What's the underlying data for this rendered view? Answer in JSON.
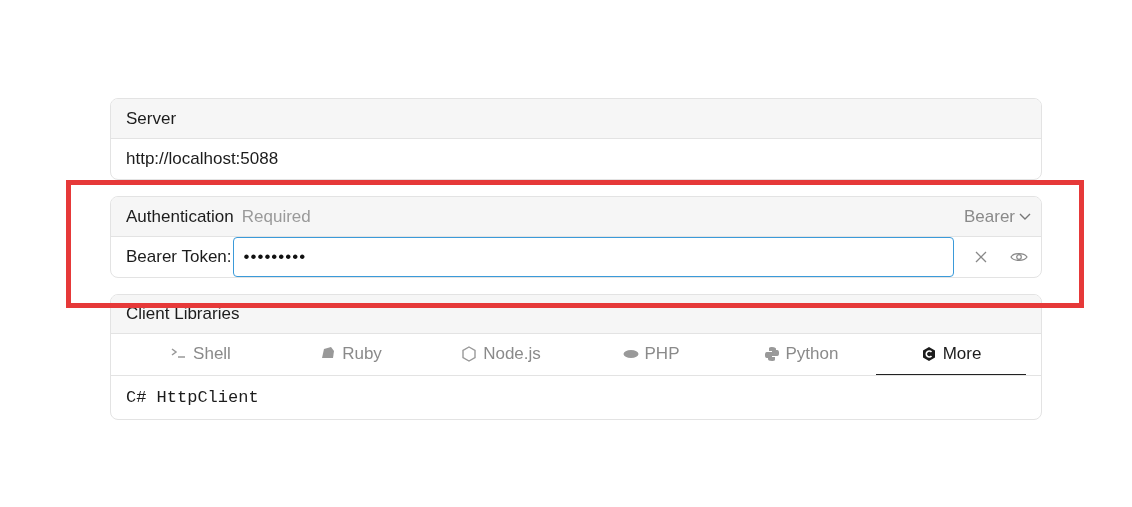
{
  "server": {
    "title": "Server",
    "url": "http://localhost:5088"
  },
  "authentication": {
    "title": "Authentication",
    "badge": "Required",
    "scheme": "Bearer",
    "token_label": "Bearer Token:",
    "token_value": "•••••••••",
    "highlighted": true
  },
  "client_libraries": {
    "title": "Client Libraries",
    "tabs": [
      {
        "label": "Shell",
        "selected": false
      },
      {
        "label": "Ruby",
        "selected": false
      },
      {
        "label": "Node.js",
        "selected": false
      },
      {
        "label": "PHP",
        "selected": false
      },
      {
        "label": "Python",
        "selected": false
      },
      {
        "label": "More",
        "selected": true
      }
    ],
    "client": "C# HttpClient"
  }
}
